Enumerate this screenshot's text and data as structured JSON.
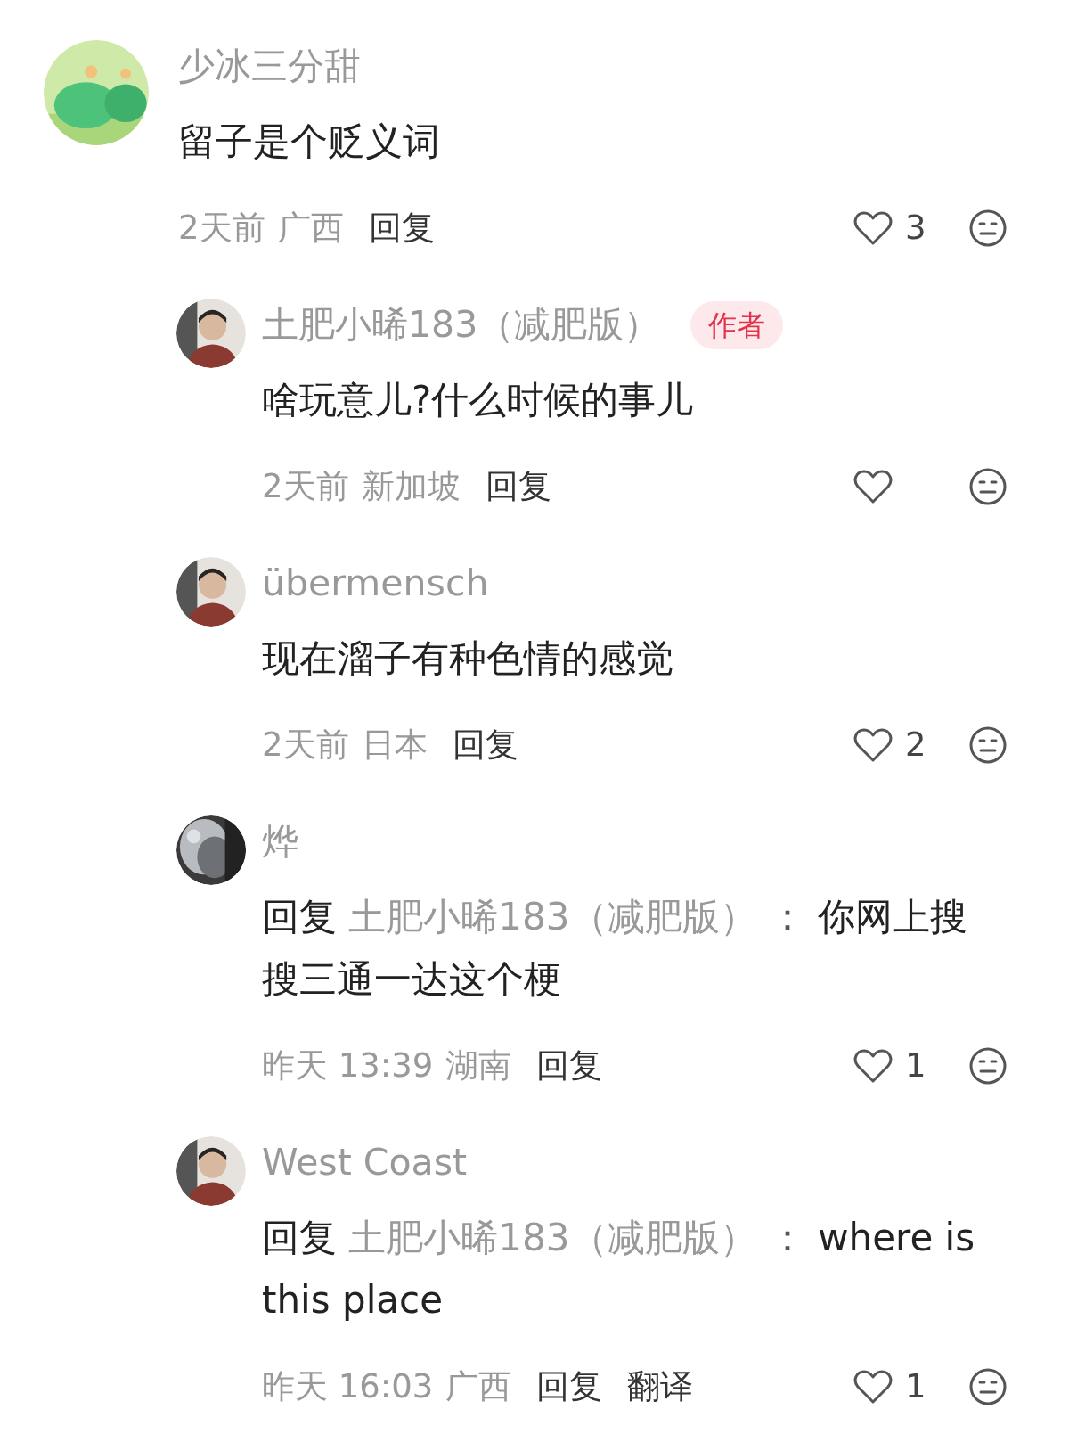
{
  "comments": [
    {
      "username": "少冰三分甜",
      "content": {
        "text": "留子是个贬义词"
      },
      "time": "2天前",
      "location": "广西",
      "actions": [
        "回复"
      ],
      "likes": "3",
      "replies": [
        {
          "username": "土肥小晞183（减肥版）",
          "badge": "作者",
          "content": {
            "text": "啥玩意儿?什么时候的事儿"
          },
          "time": "2天前",
          "location": "新加坡",
          "actions": [
            "回复"
          ]
        },
        {
          "username": "übermensch",
          "content": {
            "text": "现在溜子有种色情的感觉"
          },
          "time": "2天前",
          "location": "日本",
          "actions": [
            "回复"
          ],
          "likes": "2"
        },
        {
          "username": "烨",
          "content": {
            "reply_prefix": "回复",
            "reply_to": "土肥小晞183（减肥版）",
            "separator": "：",
            "text": "你网上搜搜三通一达这个梗"
          },
          "time": "昨天 13:39",
          "location": "湖南",
          "actions": [
            "回复"
          ],
          "likes": "1"
        },
        {
          "username": "West Coast",
          "content": {
            "reply_prefix": "回复",
            "reply_to": "土肥小晞183（减肥版）",
            "separator": "：",
            "text": "where is this place"
          },
          "time": "昨天 16:03",
          "location": "广西",
          "actions": [
            "回复",
            "翻译"
          ],
          "likes": "1"
        }
      ]
    }
  ]
}
